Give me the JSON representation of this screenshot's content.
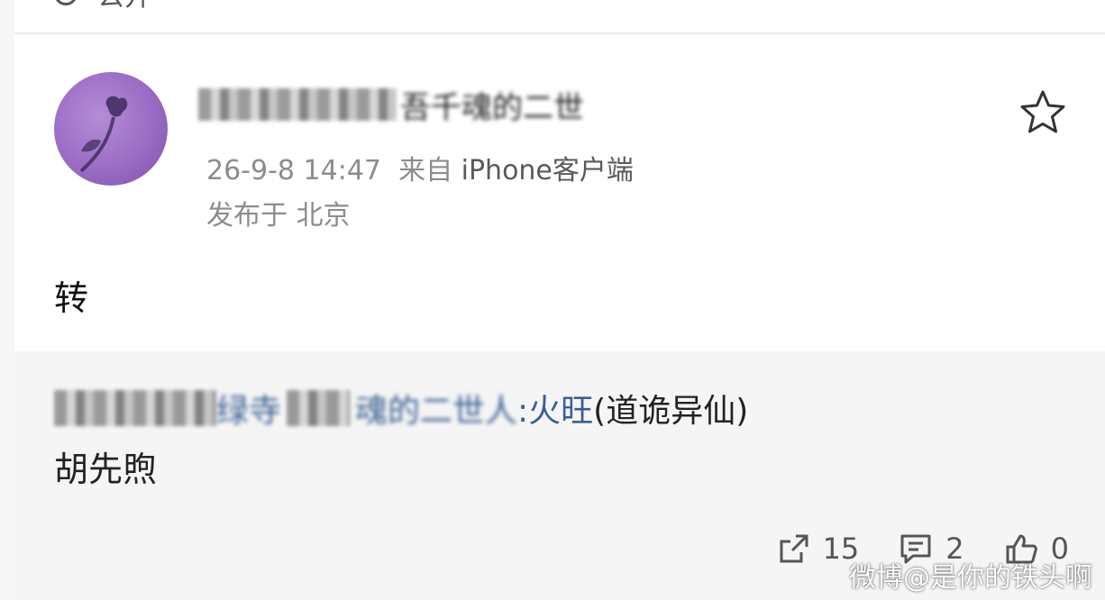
{
  "top": {
    "label": "公开"
  },
  "post": {
    "name_visible_fragment": "吾千魂的二世",
    "date": "26-9-8 14:47",
    "source_prefix": "来自",
    "source": "iPhone客户端",
    "location_prefix": "发布于",
    "location": "北京",
    "body": "转"
  },
  "quote": {
    "author_fragment_1": "绿寺",
    "author_fragment_2": "魂的二世人",
    "author_clear": ":火旺",
    "author_suffix": "(道诡异仙)",
    "text": "胡先煦",
    "repost_count": "15",
    "comment_count": "2",
    "like_count": "0"
  },
  "watermark": "微博@是你的铁头啊",
  "icons": [
    "globe-icon",
    "avatar-rose-image",
    "star-icon",
    "repost-icon",
    "comment-icon",
    "like-icon"
  ]
}
